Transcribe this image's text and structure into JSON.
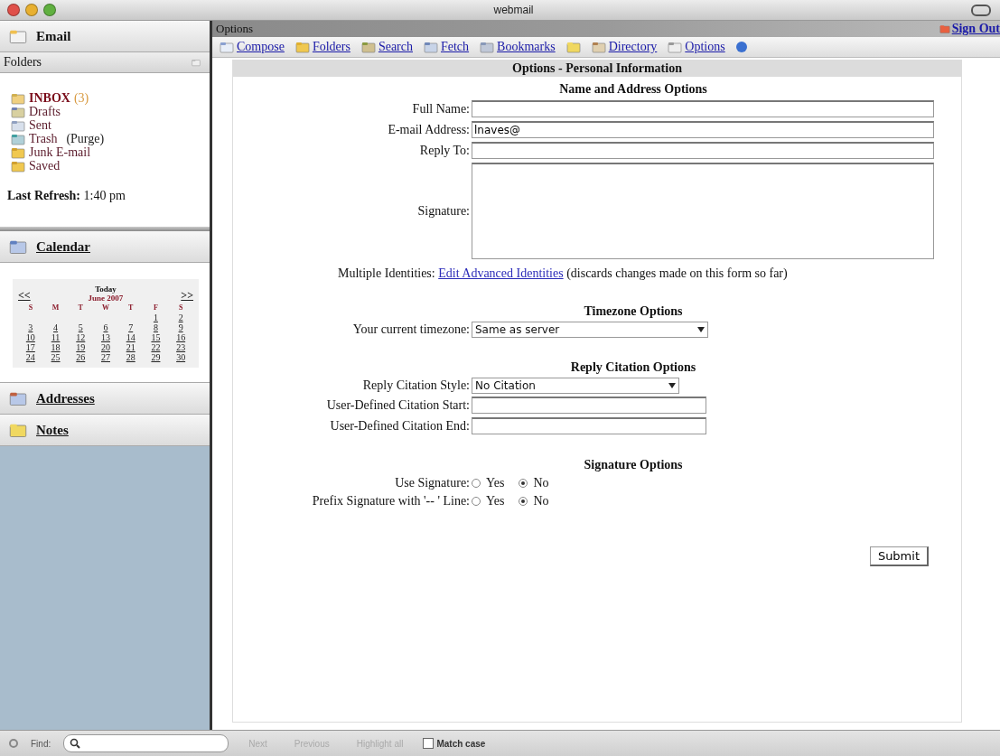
{
  "window": {
    "title": "webmail"
  },
  "sidebar": {
    "email": "Email",
    "folders_header": "Folders",
    "folders": [
      {
        "name": "INBOX",
        "count": "(3)",
        "unread": true
      },
      {
        "name": "Drafts",
        "unread": false
      },
      {
        "name": "Sent",
        "unread": false
      },
      {
        "name": "Trash",
        "extra": "(Purge)",
        "unread": false
      },
      {
        "name": "Junk E-mail",
        "unread": false
      },
      {
        "name": "Saved",
        "unread": false
      }
    ],
    "last_refresh": {
      "label": "Last Refresh:",
      "value": "1:40 pm"
    },
    "calendar": {
      "label": "Calendar",
      "today": "Today",
      "month": "June 2007",
      "prev": "<<",
      "next": ">>",
      "weekdays": [
        "S",
        "M",
        "T",
        "W",
        "T",
        "F",
        "S"
      ],
      "weeks": [
        [
          "1",
          "2"
        ],
        [
          "3",
          "4",
          "5",
          "6",
          "7",
          "8",
          "9"
        ],
        [
          "10",
          "11",
          "12",
          "13",
          "14",
          "15",
          "16"
        ],
        [
          "17",
          "18",
          "19",
          "20",
          "21",
          "22",
          "23"
        ],
        [
          "24",
          "25",
          "26",
          "27",
          "28",
          "29",
          "30"
        ]
      ]
    },
    "addresses": "Addresses",
    "notes": "Notes"
  },
  "main": {
    "header": "Options",
    "sign_out": "Sign Out",
    "toolbar": [
      {
        "label": "Compose"
      },
      {
        "label": "Folders"
      },
      {
        "label": "Search"
      },
      {
        "label": "Fetch"
      },
      {
        "label": "Bookmarks"
      },
      {
        "label": "Directory"
      },
      {
        "label": "Options"
      }
    ],
    "title": "Options - Personal Information",
    "sections": [
      {
        "title": "Name and Address Options",
        "rows": [
          {
            "kind": "text",
            "label": "Full Name:"
          },
          {
            "kind": "text",
            "label": "E-mail Address:",
            "value": "lnaves@"
          },
          {
            "kind": "text",
            "label": "Reply To:"
          },
          {
            "kind": "textarea",
            "label": "Signature:"
          },
          {
            "kind": "link",
            "label": "Multiple Identities:",
            "link": "Edit Advanced Identities",
            "note": "(discards changes made on this form so far)"
          }
        ]
      },
      {
        "title": "Timezone Options",
        "rows": [
          {
            "kind": "select",
            "label": "Your current timezone:",
            "value": "Same as server"
          }
        ]
      },
      {
        "title": "Reply Citation Options",
        "rows": [
          {
            "kind": "select",
            "label": "Reply Citation Style:",
            "value": "No Citation"
          },
          {
            "kind": "short",
            "label": "User-Defined Citation Start:"
          },
          {
            "kind": "short",
            "label": "User-Defined Citation End:"
          }
        ]
      },
      {
        "title": "Signature Options",
        "rows": [
          {
            "kind": "radio",
            "label": "Use Signature:",
            "options": [
              {
                "label": "Yes",
                "selected": false
              },
              {
                "label": "No",
                "selected": true
              }
            ]
          },
          {
            "kind": "radio",
            "label": "Prefix Signature with '-- ' Line:",
            "options": [
              {
                "label": "Yes",
                "selected": false
              },
              {
                "label": "No",
                "selected": true
              }
            ]
          }
        ]
      }
    ],
    "submit": "Submit"
  },
  "find_bar": {
    "label": "Find:",
    "buttons": [
      {
        "label": "Next",
        "disabled": true
      },
      {
        "label": "Previous",
        "disabled": true
      },
      {
        "label": "Highlight all",
        "disabled": true
      }
    ],
    "match_case": {
      "label": "Match case",
      "checked": false
    }
  }
}
